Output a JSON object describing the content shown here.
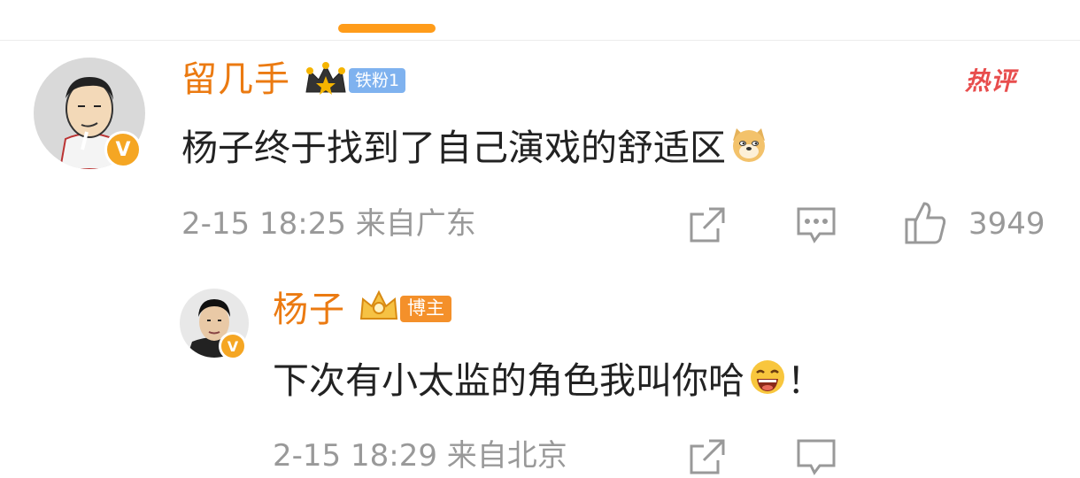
{
  "comment": {
    "username": "留几手",
    "fan_badge": "铁粉1",
    "hot_label": "热评",
    "text": "杨子终于找到了自己演戏的舒适区",
    "timestamp": "2-15 18:25",
    "location": "来自广东",
    "like_count": "3949",
    "emoji": "doge"
  },
  "reply": {
    "username": "杨子",
    "author_badge": "博主",
    "text": "下次有小太监的角色我叫你哈",
    "text_suffix": "！",
    "timestamp": "2-15 18:29",
    "location": "来自北京",
    "emoji": "laugh"
  },
  "colors": {
    "username": "#eb7a11",
    "accent": "#ff9c1a",
    "fan_badge_bg": "#7fb2ef",
    "author_badge_bg": "#f4902a",
    "hot": "#e84d4d",
    "meta": "#999999"
  },
  "icons": [
    "repost-icon",
    "comment-icon",
    "like-icon",
    "verified-v-icon",
    "crown-icon"
  ]
}
